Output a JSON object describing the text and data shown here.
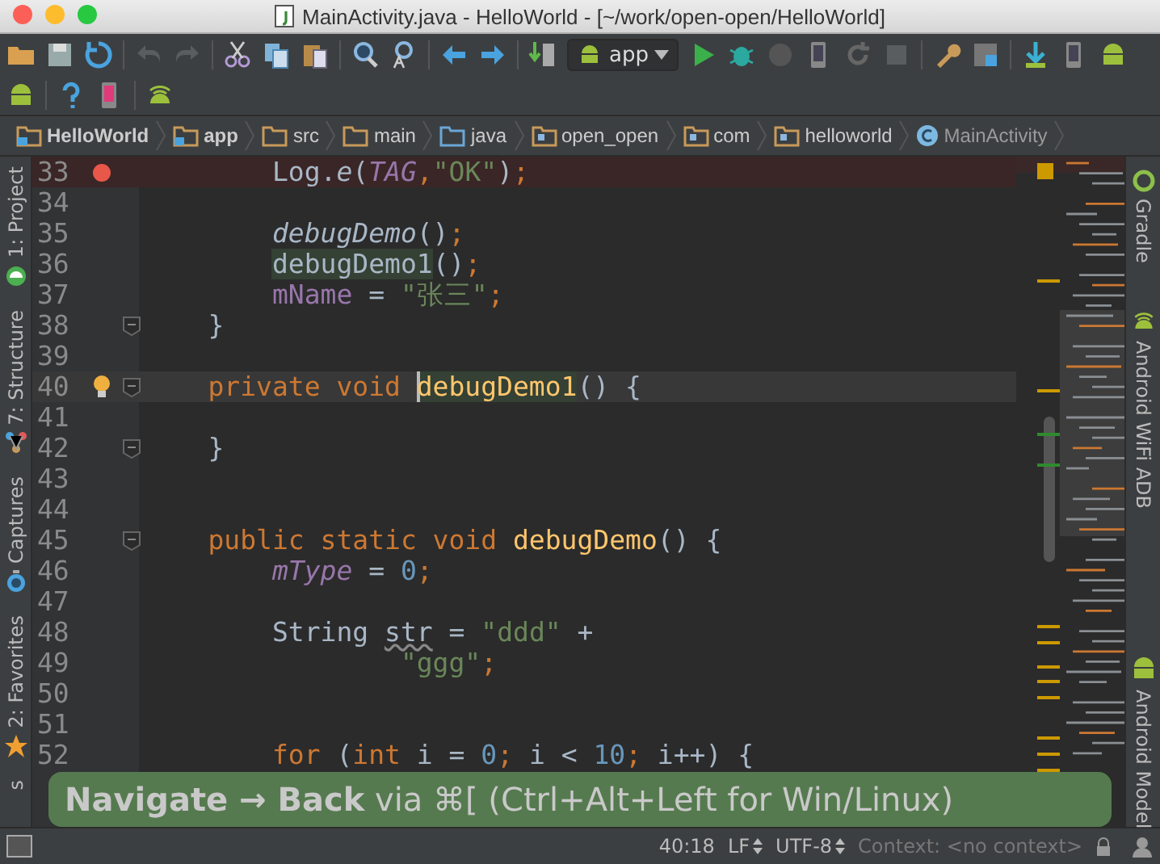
{
  "window": {
    "title": "MainActivity.java - HelloWorld - [~/work/open-open/HelloWorld]"
  },
  "toolbar": {
    "run_config": "app"
  },
  "breadcrumbs": [
    {
      "label": "HelloWorld",
      "kind": "module"
    },
    {
      "label": "app",
      "kind": "module"
    },
    {
      "label": "src",
      "kind": "folder"
    },
    {
      "label": "main",
      "kind": "folder"
    },
    {
      "label": "java",
      "kind": "source"
    },
    {
      "label": "open_open",
      "kind": "package"
    },
    {
      "label": "com",
      "kind": "package"
    },
    {
      "label": "helloworld",
      "kind": "package"
    },
    {
      "label": "MainActivity",
      "kind": "class"
    }
  ],
  "left_tool_windows": [
    {
      "label": "1: Project",
      "kind": "android"
    },
    {
      "label": "7: Structure",
      "kind": "structure"
    },
    {
      "label": "Captures",
      "kind": "captures"
    },
    {
      "label": "2: Favorites",
      "kind": "star"
    },
    {
      "label": "s",
      "kind": "none"
    }
  ],
  "right_tool_windows": [
    {
      "label": "Gradle",
      "kind": "gradle"
    },
    {
      "label": "Android WiFi ADB",
      "kind": "wifi"
    },
    {
      "label": "Android Model",
      "kind": "android"
    }
  ],
  "editor": {
    "lines": [
      {
        "number": "33",
        "breakpoint": true,
        "fold": false,
        "bulb": false,
        "current": false,
        "tokens": [
          {
            "text": "        Log.",
            "kind": "plain"
          },
          {
            "text": "e",
            "kind": "static-call"
          },
          {
            "text": "(",
            "kind": "plain"
          },
          {
            "text": "TAG",
            "kind": "static-field"
          },
          {
            "text": ",",
            "kind": "keyword"
          },
          {
            "text": "\"OK\"",
            "kind": "string"
          },
          {
            "text": ")",
            "kind": "plain"
          },
          {
            "text": ";",
            "kind": "keyword"
          }
        ]
      },
      {
        "number": "34",
        "breakpoint": false,
        "fold": false,
        "bulb": false,
        "current": false
      },
      {
        "number": "35",
        "breakpoint": false,
        "fold": false,
        "bulb": false,
        "current": false,
        "kind": "body",
        "tokens": [
          {
            "text": "debugDemo",
            "kind": "static-call"
          },
          {
            "text": "()",
            "kind": "plain"
          },
          {
            "text": ";",
            "kind": "keyword"
          }
        ]
      },
      {
        "number": "36",
        "breakpoint": false,
        "fold": false,
        "bulb": false,
        "current": false,
        "kind": "body",
        "tokens": [
          {
            "text": "debugDemo1",
            "kind": "usage"
          },
          {
            "text": "()",
            "kind": "plain"
          },
          {
            "text": ";",
            "kind": "keyword"
          }
        ]
      },
      {
        "number": "37",
        "breakpoint": false,
        "fold": false,
        "bulb": false,
        "current": false,
        "kind": "body",
        "tokens": [
          {
            "text": "mName",
            "kind": "field"
          },
          {
            "text": " = ",
            "kind": "plain"
          },
          {
            "text": "\"张三\"",
            "kind": "string"
          },
          {
            "text": ";",
            "kind": "keyword"
          }
        ]
      },
      {
        "number": "38",
        "breakpoint": false,
        "fold": true,
        "bulb": false,
        "current": false,
        "tokens": [
          {
            "text": "    }",
            "kind": "plain"
          }
        ]
      },
      {
        "number": "39",
        "breakpoint": false,
        "fold": false,
        "bulb": false,
        "current": false
      },
      {
        "number": "40",
        "breakpoint": false,
        "fold": true,
        "bulb": true,
        "current": true,
        "kind": "member",
        "tokens": [
          {
            "text": "private void ",
            "kind": "keyword"
          },
          {
            "text": "debugDemo1",
            "kind": "declaration-usage"
          },
          {
            "text": "() {",
            "kind": "plain"
          }
        ]
      },
      {
        "number": "41",
        "breakpoint": false,
        "fold": false,
        "bulb": false,
        "current": false
      },
      {
        "number": "42",
        "breakpoint": false,
        "fold": true,
        "bulb": false,
        "current": false,
        "tokens": [
          {
            "text": "    }",
            "kind": "plain"
          }
        ]
      },
      {
        "number": "43",
        "breakpoint": false,
        "fold": false,
        "bulb": false,
        "current": false
      },
      {
        "number": "44",
        "breakpoint": false,
        "fold": false,
        "bulb": false,
        "current": false
      },
      {
        "number": "45",
        "breakpoint": false,
        "fold": true,
        "bulb": false,
        "current": false,
        "kind": "member",
        "tokens": [
          {
            "text": "public static void ",
            "kind": "keyword"
          },
          {
            "text": "debugDemo",
            "kind": "declaration"
          },
          {
            "text": "() {",
            "kind": "plain"
          }
        ]
      },
      {
        "number": "46",
        "breakpoint": false,
        "fold": false,
        "bulb": false,
        "current": false,
        "kind": "body",
        "tokens": [
          {
            "text": "mType",
            "kind": "static-field"
          },
          {
            "text": " = ",
            "kind": "plain"
          },
          {
            "text": "0",
            "kind": "number"
          },
          {
            "text": ";",
            "kind": "keyword"
          }
        ]
      },
      {
        "number": "47",
        "breakpoint": false,
        "fold": false,
        "bulb": false,
        "current": false
      },
      {
        "number": "48",
        "breakpoint": false,
        "fold": false,
        "bulb": false,
        "current": false,
        "tokens": [
          {
            "text": "        String ",
            "kind": "plain"
          },
          {
            "text": "str",
            "kind": "unused"
          },
          {
            "text": " = ",
            "kind": "plain"
          },
          {
            "text": "\"ddd\"",
            "kind": "string"
          },
          {
            "text": " +",
            "kind": "plain"
          }
        ]
      },
      {
        "number": "49",
        "breakpoint": false,
        "fold": false,
        "bulb": false,
        "current": false,
        "kind": "continuation",
        "tokens": [
          {
            "text": "\"ggg\"",
            "kind": "string"
          },
          {
            "text": ";",
            "kind": "keyword"
          }
        ]
      },
      {
        "number": "50",
        "breakpoint": false,
        "fold": false,
        "bulb": false,
        "current": false
      },
      {
        "number": "51",
        "breakpoint": false,
        "fold": false,
        "bulb": false,
        "current": false
      },
      {
        "number": "52",
        "breakpoint": false,
        "fold": false,
        "bulb": false,
        "current": false,
        "kind": "body",
        "tokens": [
          {
            "text": "for",
            "kind": "keyword"
          },
          {
            "text": " (",
            "kind": "plain"
          },
          {
            "text": "int",
            "kind": "keyword"
          },
          {
            "text": " i = ",
            "kind": "plain"
          },
          {
            "text": "0",
            "kind": "number"
          },
          {
            "text": ";",
            "kind": "keyword"
          },
          {
            "text": " i < ",
            "kind": "plain"
          },
          {
            "text": "10",
            "kind": "number"
          },
          {
            "text": ";",
            "kind": "keyword"
          },
          {
            "text": " i++) {",
            "kind": "plain"
          }
        ]
      }
    ]
  },
  "toast": {
    "text": "**Navigate → Back** via ⌘[ (Ctrl+Alt+Left for Win/Linux)"
  },
  "status_bar": {
    "position": "40:18",
    "line_separator": "LF",
    "encoding": "UTF-8",
    "context": "Context: <no context>"
  }
}
